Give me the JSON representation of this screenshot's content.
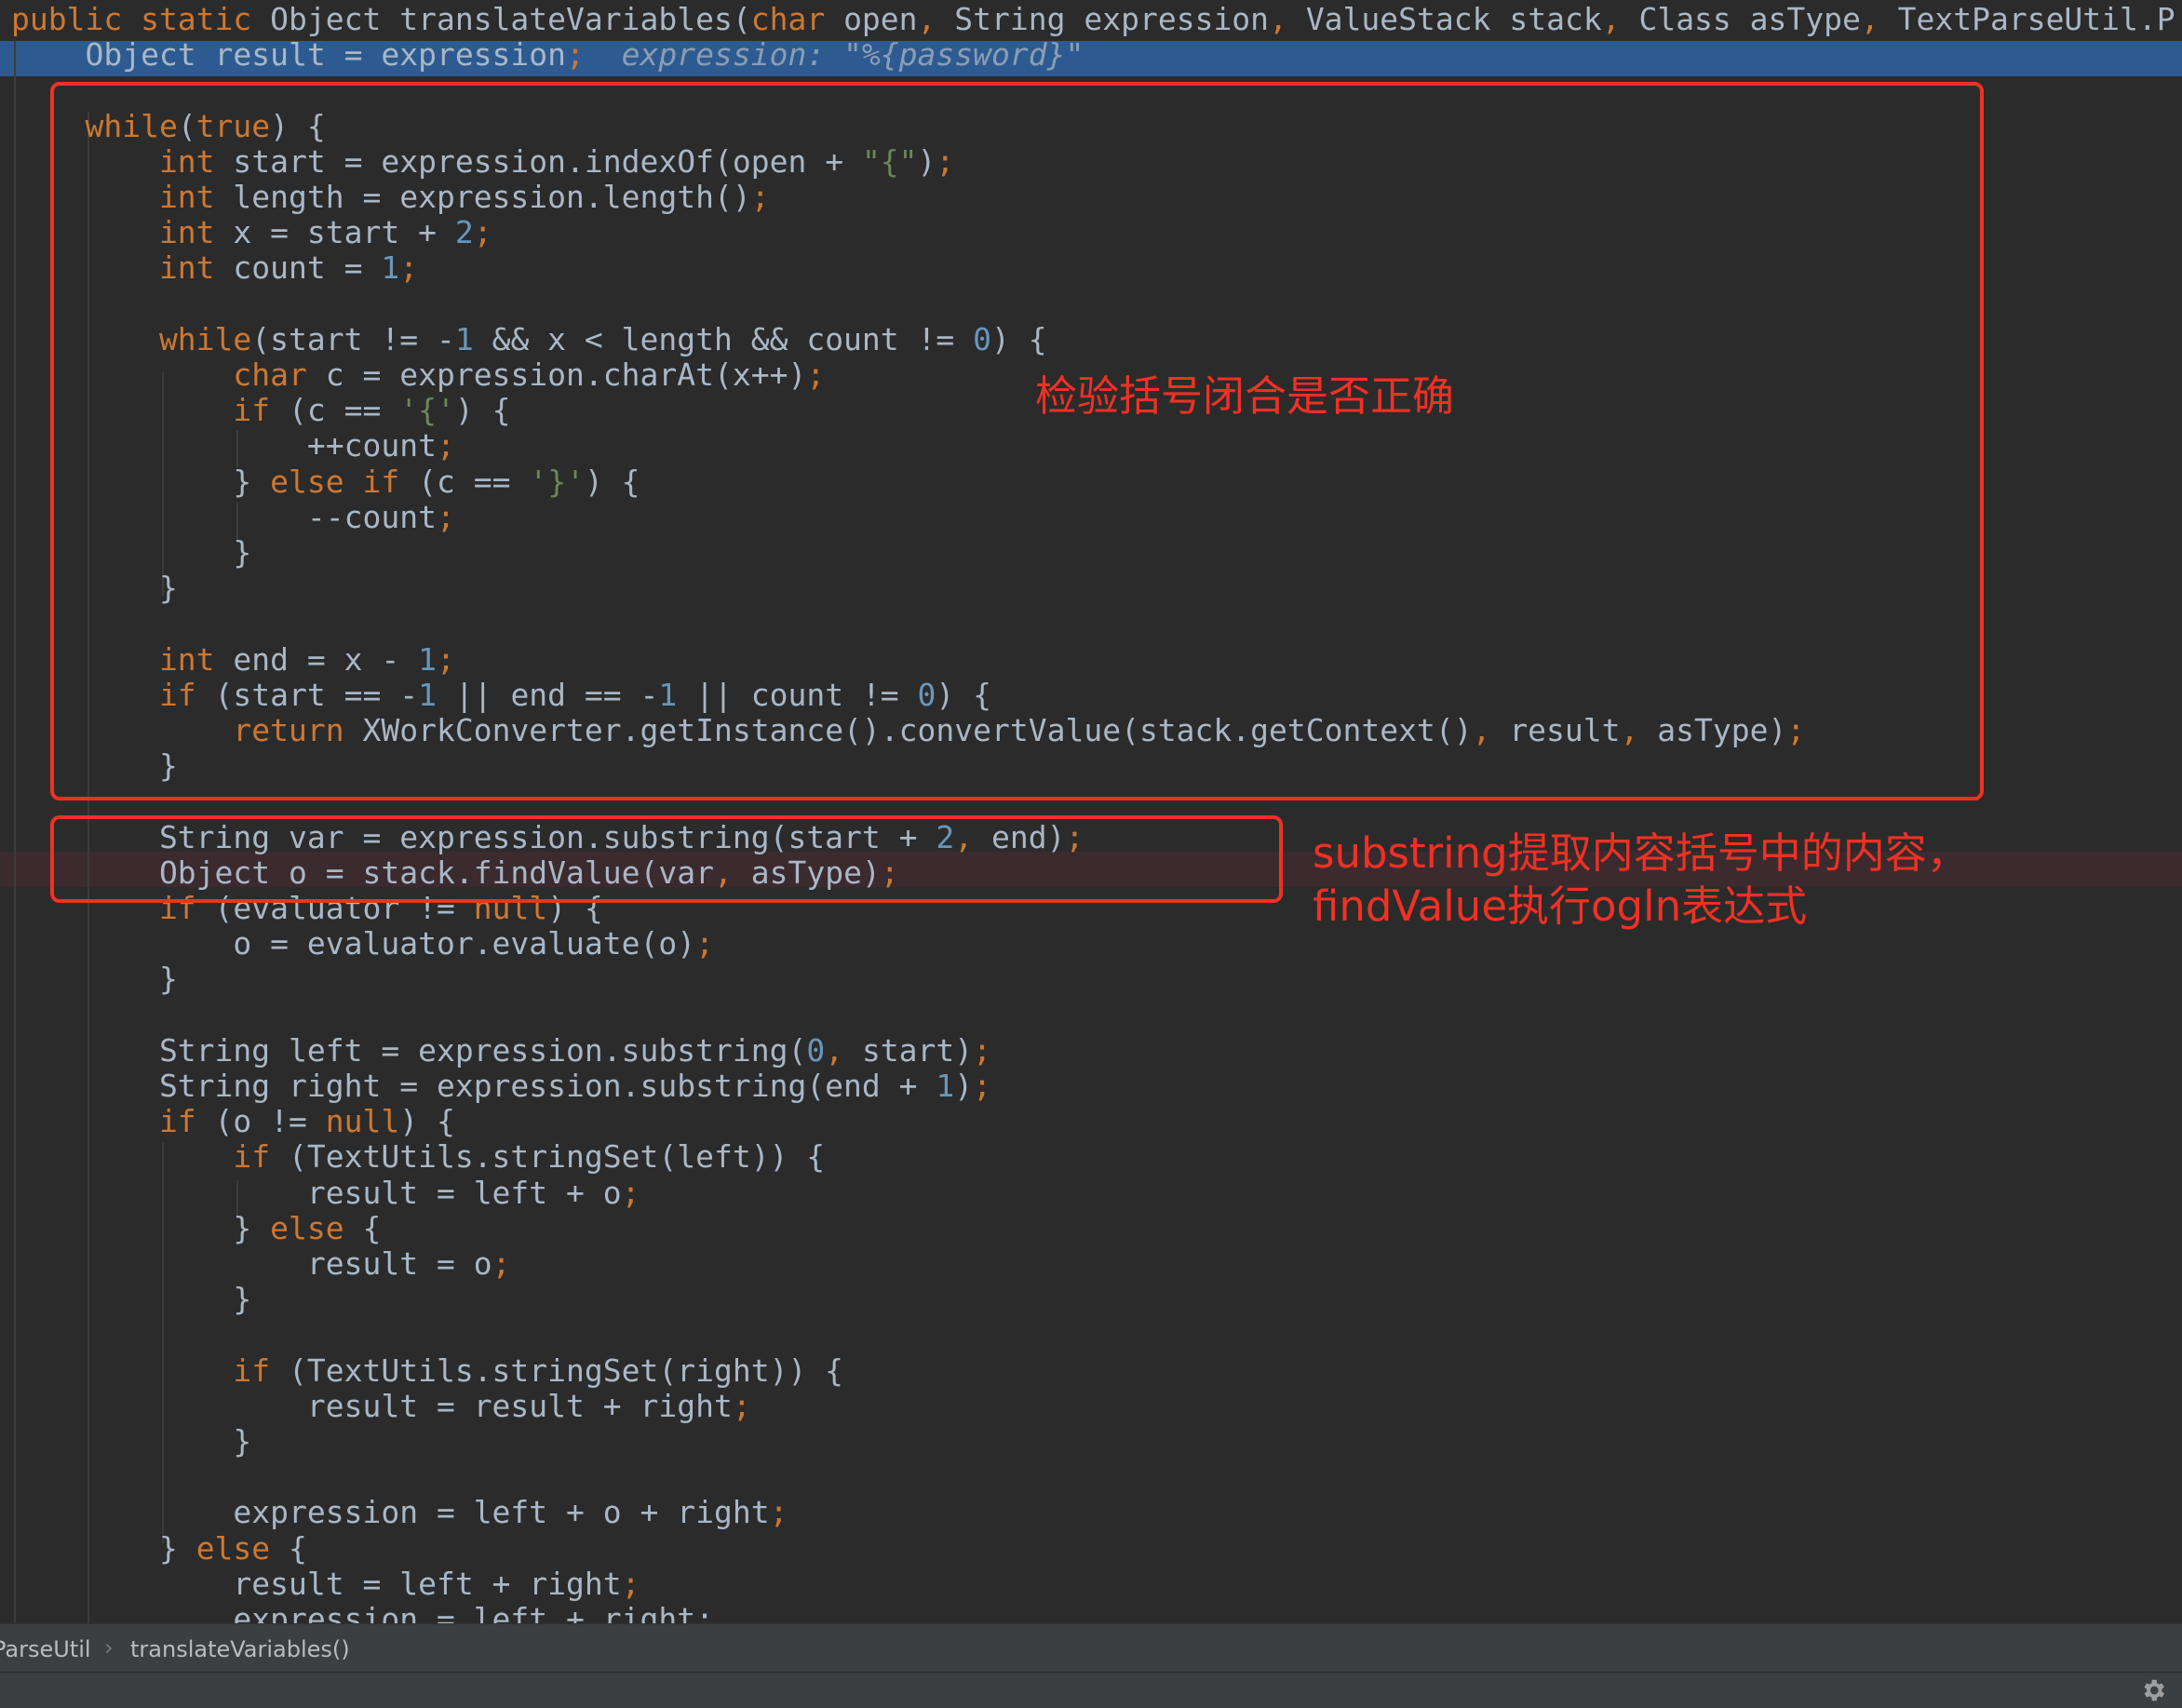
{
  "code": {
    "lines": [
      {
        "segs": [
          [
            "kw",
            "public static "
          ],
          [
            "",
            "Object translateVariables("
          ],
          [
            "kw",
            "char "
          ],
          [
            "",
            "open"
          ],
          [
            "kw",
            ", "
          ],
          [
            "",
            "String expression"
          ],
          [
            "kw",
            ", "
          ],
          [
            "",
            "ValueStack stack"
          ],
          [
            "kw",
            ", "
          ],
          [
            "",
            "Class asType"
          ],
          [
            "kw",
            ", "
          ],
          [
            "",
            "TextParseUtil.P"
          ]
        ]
      },
      {
        "segs": [
          [
            "",
            "    Object result = expression"
          ],
          [
            "kw",
            ";"
          ],
          [
            "",
            "  "
          ],
          [
            "hint",
            "expression: \"%{password}\""
          ]
        ]
      },
      {
        "segs": []
      },
      {
        "segs": [
          [
            "kw",
            "    while"
          ],
          [
            "",
            "("
          ],
          [
            "kw",
            "true"
          ],
          [
            "",
            ") {"
          ]
        ]
      },
      {
        "segs": [
          [
            "kw",
            "        int "
          ],
          [
            "",
            "start = expression.indexOf(open + "
          ],
          [
            "str",
            "\"{\""
          ],
          [
            "",
            ")"
          ],
          [
            "kw",
            ";"
          ]
        ]
      },
      {
        "segs": [
          [
            "kw",
            "        int "
          ],
          [
            "",
            "length = expression.length()"
          ],
          [
            "kw",
            ";"
          ]
        ]
      },
      {
        "segs": [
          [
            "kw",
            "        int "
          ],
          [
            "",
            "x = start + "
          ],
          [
            "num",
            "2"
          ],
          [
            "kw",
            ";"
          ]
        ]
      },
      {
        "segs": [
          [
            "kw",
            "        int "
          ],
          [
            "",
            "count = "
          ],
          [
            "num",
            "1"
          ],
          [
            "kw",
            ";"
          ]
        ]
      },
      {
        "segs": []
      },
      {
        "segs": [
          [
            "kw",
            "        while"
          ],
          [
            "",
            "(start != -"
          ],
          [
            "num",
            "1"
          ],
          [
            "",
            " && x < length && count != "
          ],
          [
            "num",
            "0"
          ],
          [
            "",
            ") {"
          ]
        ]
      },
      {
        "segs": [
          [
            "kw",
            "            char "
          ],
          [
            "",
            "c = expression.charAt(x++)"
          ],
          [
            "kw",
            ";"
          ]
        ]
      },
      {
        "segs": [
          [
            "kw",
            "            if "
          ],
          [
            "",
            "(c == "
          ],
          [
            "str",
            "'{'"
          ],
          [
            "",
            ") {"
          ]
        ]
      },
      {
        "segs": [
          [
            "",
            "                ++count"
          ],
          [
            "kw",
            ";"
          ]
        ]
      },
      {
        "segs": [
          [
            "",
            "            } "
          ],
          [
            "kw",
            "else if "
          ],
          [
            "",
            "(c == "
          ],
          [
            "str",
            "'}'"
          ],
          [
            "",
            ") {"
          ]
        ]
      },
      {
        "segs": [
          [
            "",
            "                --count"
          ],
          [
            "kw",
            ";"
          ]
        ]
      },
      {
        "segs": [
          [
            "",
            "            }"
          ]
        ]
      },
      {
        "segs": [
          [
            "",
            "        }"
          ]
        ]
      },
      {
        "segs": []
      },
      {
        "segs": [
          [
            "kw",
            "        int "
          ],
          [
            "",
            "end = x - "
          ],
          [
            "num",
            "1"
          ],
          [
            "kw",
            ";"
          ]
        ]
      },
      {
        "segs": [
          [
            "kw",
            "        if "
          ],
          [
            "",
            "(start == -"
          ],
          [
            "num",
            "1"
          ],
          [
            "",
            " || end == -"
          ],
          [
            "num",
            "1"
          ],
          [
            "",
            " || count != "
          ],
          [
            "num",
            "0"
          ],
          [
            "",
            ") {"
          ]
        ]
      },
      {
        "segs": [
          [
            "kw",
            "            return "
          ],
          [
            "",
            "XWorkConverter.getInstance().convertValue(stack.getContext()"
          ],
          [
            "kw",
            ", "
          ],
          [
            "",
            "result"
          ],
          [
            "kw",
            ", "
          ],
          [
            "",
            "asType)"
          ],
          [
            "kw",
            ";"
          ]
        ]
      },
      {
        "segs": [
          [
            "",
            "        }"
          ]
        ]
      },
      {
        "segs": []
      },
      {
        "segs": [
          [
            "",
            "        String var = expression.substring(start + "
          ],
          [
            "num",
            "2"
          ],
          [
            "kw",
            ", "
          ],
          [
            "",
            "end)"
          ],
          [
            "kw",
            ";"
          ]
        ]
      },
      {
        "segs": [
          [
            "",
            "        Object o = stack.findValue(var"
          ],
          [
            "kw",
            ", "
          ],
          [
            "",
            "asType)"
          ],
          [
            "kw",
            ";"
          ]
        ]
      },
      {
        "segs": [
          [
            "kw",
            "        if "
          ],
          [
            "",
            "(evaluator != "
          ],
          [
            "kw",
            "null"
          ],
          [
            "",
            ") {"
          ]
        ]
      },
      {
        "segs": [
          [
            "",
            "            o = evaluator.evaluate(o)"
          ],
          [
            "kw",
            ";"
          ]
        ]
      },
      {
        "segs": [
          [
            "",
            "        }"
          ]
        ]
      },
      {
        "segs": []
      },
      {
        "segs": [
          [
            "",
            "        String left = expression.substring("
          ],
          [
            "num",
            "0"
          ],
          [
            "kw",
            ", "
          ],
          [
            "",
            "start)"
          ],
          [
            "kw",
            ";"
          ]
        ]
      },
      {
        "segs": [
          [
            "",
            "        String right = expression.substring(end + "
          ],
          [
            "num",
            "1"
          ],
          [
            "",
            ")"
          ],
          [
            "kw",
            ";"
          ]
        ]
      },
      {
        "segs": [
          [
            "kw",
            "        if "
          ],
          [
            "",
            "(o != "
          ],
          [
            "kw",
            "null"
          ],
          [
            "",
            ") {"
          ]
        ]
      },
      {
        "segs": [
          [
            "kw",
            "            if "
          ],
          [
            "",
            "(TextUtils.stringSet(left)) {"
          ]
        ]
      },
      {
        "segs": [
          [
            "",
            "                result = left + o"
          ],
          [
            "kw",
            ";"
          ]
        ]
      },
      {
        "segs": [
          [
            "",
            "            } "
          ],
          [
            "kw",
            "else "
          ],
          [
            "",
            "{"
          ]
        ]
      },
      {
        "segs": [
          [
            "",
            "                result = o"
          ],
          [
            "kw",
            ";"
          ]
        ]
      },
      {
        "segs": [
          [
            "",
            "            }"
          ]
        ]
      },
      {
        "segs": []
      },
      {
        "segs": [
          [
            "kw",
            "            if "
          ],
          [
            "",
            "(TextUtils.stringSet(right)) {"
          ]
        ]
      },
      {
        "segs": [
          [
            "",
            "                result = result + right"
          ],
          [
            "kw",
            ";"
          ]
        ]
      },
      {
        "segs": [
          [
            "",
            "            }"
          ]
        ]
      },
      {
        "segs": []
      },
      {
        "segs": [
          [
            "",
            "            expression = left + o + right"
          ],
          [
            "kw",
            ";"
          ]
        ]
      },
      {
        "segs": [
          [
            "",
            "        } "
          ],
          [
            "kw",
            "else "
          ],
          [
            "",
            "{"
          ]
        ]
      },
      {
        "segs": [
          [
            "",
            "            result = left + right"
          ],
          [
            "kw",
            ";"
          ]
        ]
      },
      {
        "segs": [
          [
            "",
            "            expression = left + right;"
          ]
        ]
      }
    ]
  },
  "annotations": {
    "bracket_check": "检验括号闭合是否正确",
    "substring_line1": "substring提取内容括号中的内容，",
    "substring_line2": "findValue执行ogln表达式"
  },
  "breadcrumb": {
    "class_name": "ParseUtil",
    "method_name": "translateVariables()"
  },
  "status_icon": "gear-icon",
  "colors": {
    "background": "#2b2b2b",
    "keyword": "#cc7832",
    "number": "#6897bb",
    "string": "#6a8759",
    "identifier": "#a9b7c6",
    "execution_line": "#2d5b91",
    "annotation": "#ef3124"
  }
}
